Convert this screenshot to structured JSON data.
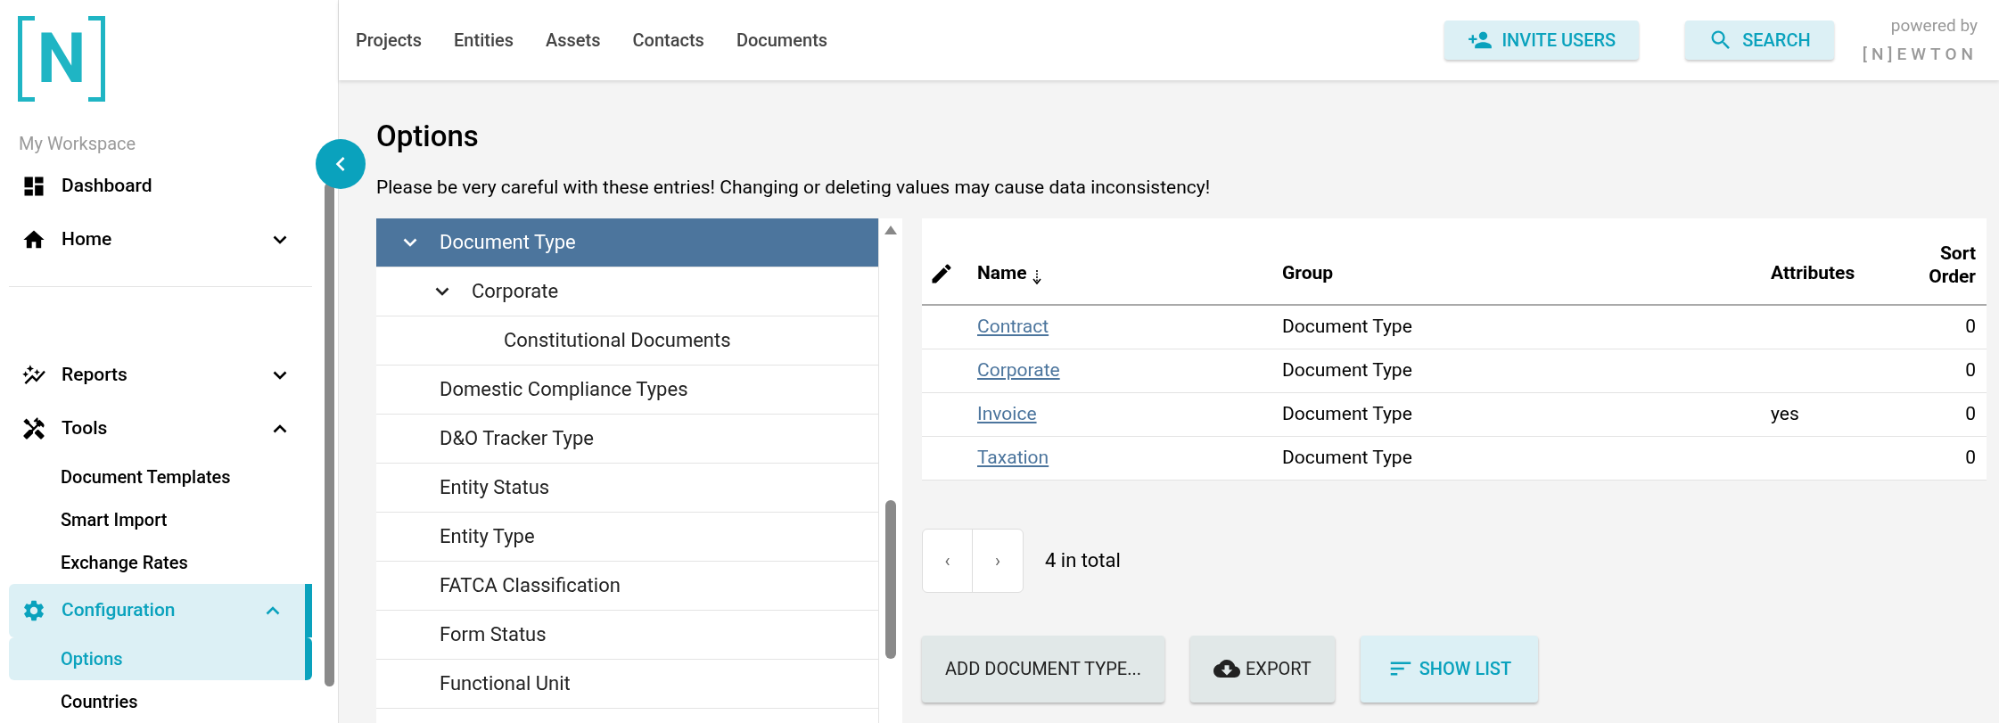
{
  "logo": {
    "letter": "N"
  },
  "sidebar": {
    "section_label": "My Workspace",
    "items": [
      {
        "label": "Dashboard",
        "selected": false
      },
      {
        "label": "Home",
        "selected": false,
        "expanded": false
      },
      {
        "kind": "divider"
      },
      {
        "label": "Reports",
        "selected": false,
        "expanded": false
      },
      {
        "label": "Tools",
        "selected": false,
        "expanded": true,
        "children": [
          {
            "label": "Document Templates",
            "selected": false
          },
          {
            "label": "Smart Import",
            "selected": false
          },
          {
            "label": "Exchange Rates",
            "selected": false
          }
        ]
      },
      {
        "label": "Configuration",
        "selected": true,
        "expanded": true,
        "children": [
          {
            "label": "Options",
            "selected": true
          },
          {
            "label": "Countries",
            "selected": false
          }
        ]
      }
    ]
  },
  "top_nav": {
    "links": [
      "Projects",
      "Entities",
      "Assets",
      "Contacts",
      "Documents"
    ],
    "buttons": [
      {
        "label": "INVITE USERS"
      },
      {
        "label": "SEARCH"
      }
    ],
    "powered_by": {
      "label": "powered by",
      "logo_text": "[N]EWTON"
    }
  },
  "page": {
    "title": "Options",
    "warning": "Please be very careful with these entries! Changing or deleting values may cause data inconsistency!"
  },
  "tree": [
    {
      "label": "Document Type",
      "selected": true,
      "expanded": true,
      "children": [
        {
          "label": "Corporate",
          "selected": false,
          "expanded": true,
          "children": [
            {
              "label": "Constitutional Documents",
              "selected": false
            }
          ]
        }
      ]
    },
    {
      "label": "Domestic Compliance Types",
      "selected": false
    },
    {
      "label": "D&O Tracker Type",
      "selected": false
    },
    {
      "label": "Entity Status",
      "selected": false
    },
    {
      "label": "Entity Type",
      "selected": false
    },
    {
      "label": "FATCA Classification",
      "selected": false
    },
    {
      "label": "Form Status",
      "selected": false
    },
    {
      "label": "Functional Unit",
      "selected": false
    }
  ],
  "table": {
    "columns": [
      {
        "label": "Name",
        "sorted": true
      },
      {
        "label": "Group",
        "sorted": false
      },
      {
        "label": "Attributes",
        "sorted": false
      },
      {
        "label": "Sort Order",
        "sorted": false
      }
    ],
    "rows": [
      {
        "name": "Contract",
        "group": "Document Type",
        "sort_order": "0"
      },
      {
        "name": "Corporate",
        "group": "Document Type",
        "sort_order": "0"
      },
      {
        "name": "Invoice",
        "group": "Document Type",
        "attributes": "yes",
        "sort_order": "0"
      },
      {
        "name": "Taxation",
        "group": "Document Type",
        "sort_order": "0"
      }
    ]
  },
  "pagination": {
    "prev": "‹",
    "next": "›",
    "total": "4 in total"
  },
  "actions": [
    {
      "label": "ADD DOCUMENT TYPE...",
      "kind": "plain"
    },
    {
      "label": "EXPORT",
      "kind": "export"
    },
    {
      "label": "SHOW LIST",
      "kind": "list"
    }
  ]
}
